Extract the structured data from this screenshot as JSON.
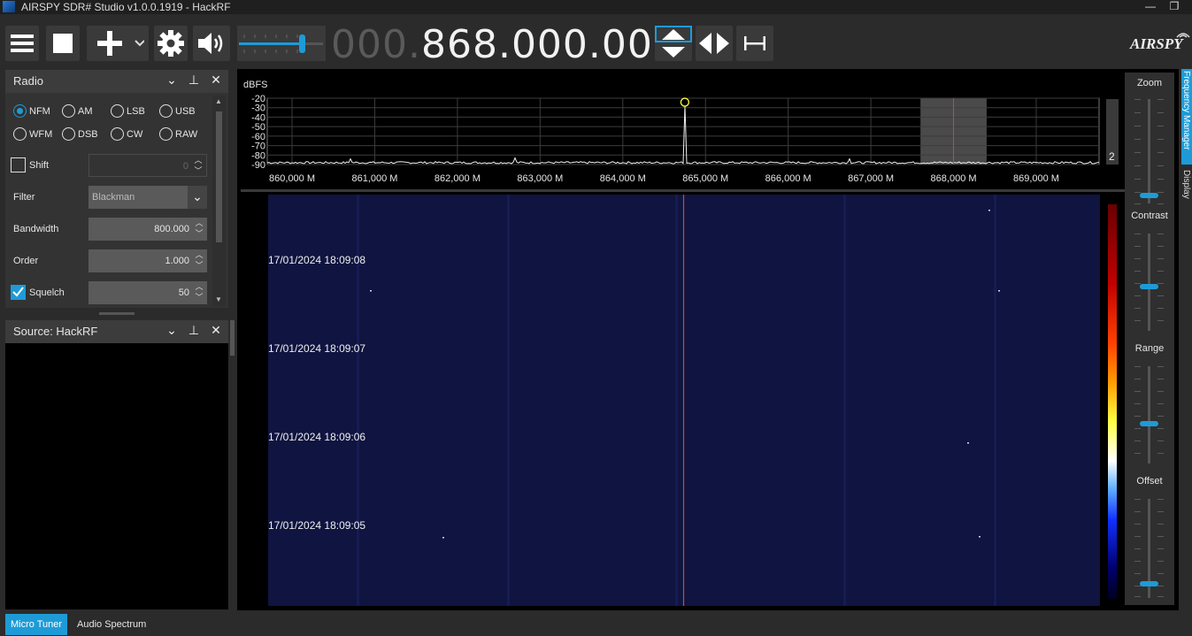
{
  "window": {
    "title": "AIRSPY SDR# Studio v1.0.0.1919 - HackRF",
    "minimize": "—",
    "restore": "❐"
  },
  "toolbar": {
    "frequency_dim": "000.",
    "frequency_main": "868.000.000",
    "volume_level": 0.78,
    "logo": "AIRSPY"
  },
  "radio_panel": {
    "title": "Radio",
    "modes": [
      {
        "label": "NFM",
        "selected": true
      },
      {
        "label": "AM",
        "selected": false
      },
      {
        "label": "LSB",
        "selected": false
      },
      {
        "label": "USB",
        "selected": false
      },
      {
        "label": "WFM",
        "selected": false
      },
      {
        "label": "DSB",
        "selected": false
      },
      {
        "label": "CW",
        "selected": false
      },
      {
        "label": "RAW",
        "selected": false
      }
    ],
    "shift": {
      "label": "Shift",
      "checked": false,
      "value": "0"
    },
    "filter": {
      "label": "Filter",
      "value": "Blackman"
    },
    "bandwidth": {
      "label": "Bandwidth",
      "value": "800.000"
    },
    "order": {
      "label": "Order",
      "value": "1.000"
    },
    "squelch": {
      "label": "Squelch",
      "checked": true,
      "value": "50"
    }
  },
  "source_panel": {
    "title": "Source: HackRF"
  },
  "spectrum": {
    "unit_label": "dBFS",
    "y_ticks": [
      "-20",
      "-30",
      "-40",
      "-50",
      "-60",
      "-70",
      "-80",
      "-90"
    ],
    "x_ticks": [
      "860,000 M",
      "861,000 M",
      "862,000 M",
      "863,000 M",
      "864,000 M",
      "865,000 M",
      "866,000 M",
      "867,000 M",
      "868,000 M",
      "869,000 M"
    ],
    "side_value": "2",
    "peak_freq_mhz": 864.75,
    "peak_dbfs": -28,
    "center_freq_mhz": 868.0,
    "filter_band_mhz": [
      867.6,
      868.4
    ],
    "noise_floor_dbfs": -88
  },
  "waterfall": {
    "timestamps": [
      "17/01/2024 18:09:08",
      "17/01/2024 18:09:07",
      "17/01/2024 18:09:06",
      "17/01/2024 18:09:05"
    ]
  },
  "right_panel": {
    "zoom_label": "Zoom",
    "contrast_label": "Contrast",
    "range_label": "Range",
    "offset_label": "Offset",
    "vertical_tab_1": "Frequency Manager",
    "vertical_tab_2": "Display"
  },
  "bottom_tabs": {
    "micro_tuner": "Micro Tuner",
    "audio_spectrum": "Audio Spectrum"
  },
  "colors": {
    "accent": "#1e9bd7",
    "waterfall_bg": "#0f1440",
    "marker": "#e0442a"
  }
}
